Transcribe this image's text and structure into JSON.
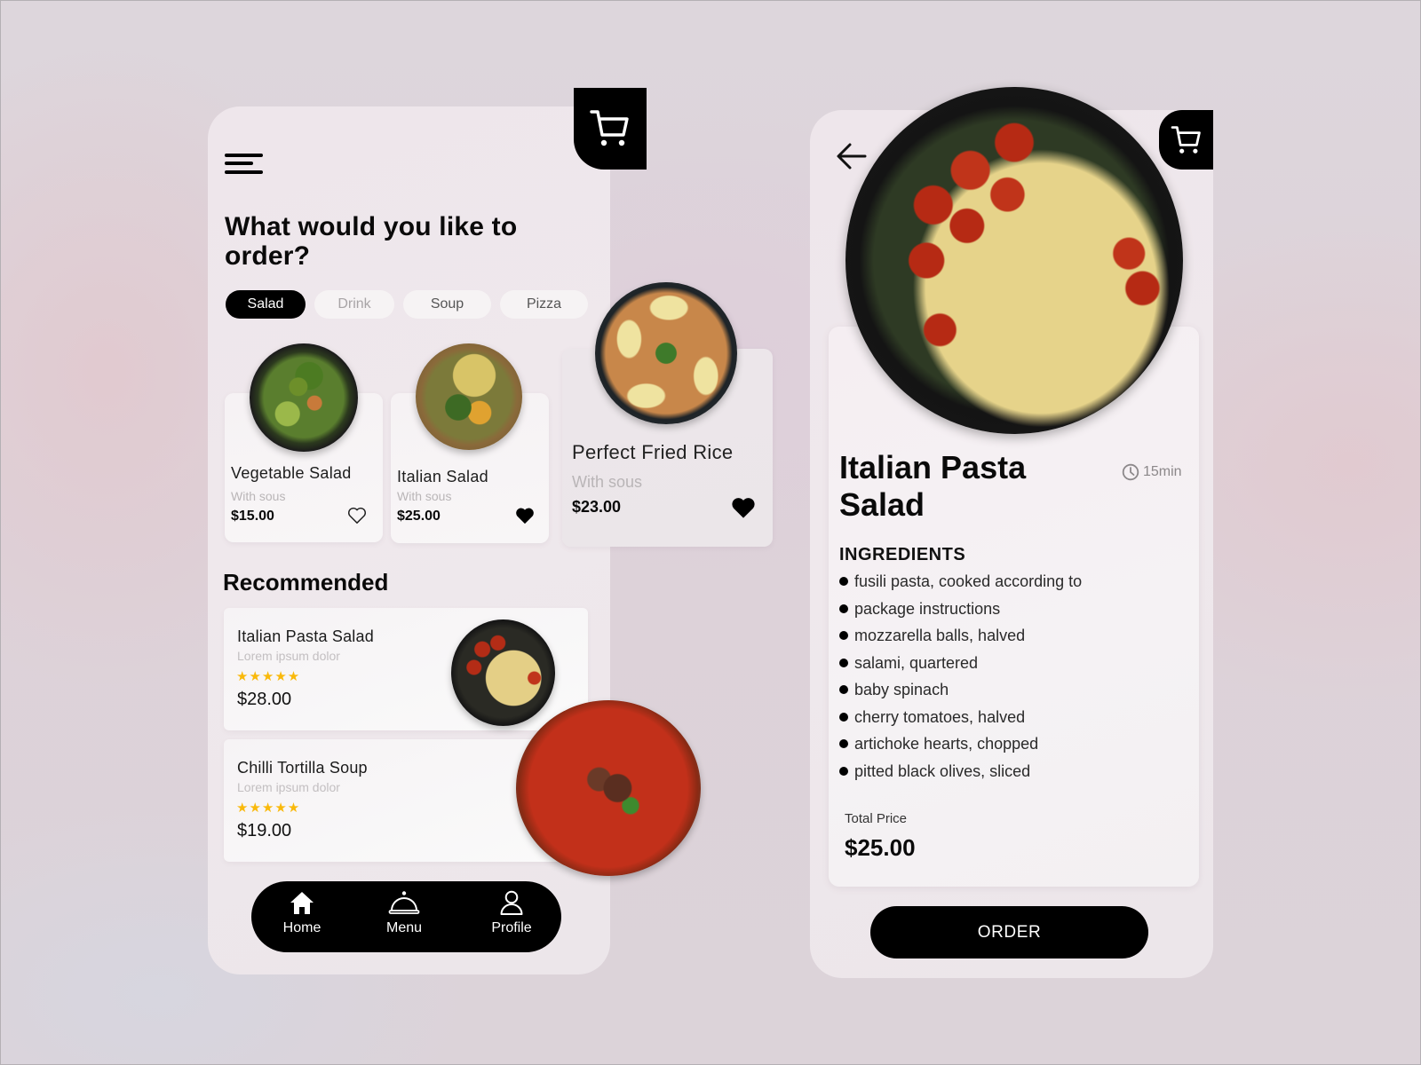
{
  "home": {
    "title": "What would you like to order?",
    "categories": [
      {
        "label": "Salad",
        "active": true
      },
      {
        "label": "Drink",
        "active": false
      },
      {
        "label": "Soup",
        "active": false
      },
      {
        "label": "Pizza",
        "active": false
      }
    ],
    "featured": [
      {
        "name": "Vegetable Salad",
        "subtitle": "With sous",
        "price": "$15.00",
        "favorite": false
      },
      {
        "name": "Italian Salad",
        "subtitle": "With sous",
        "price": "$25.00",
        "favorite": true
      },
      {
        "name": "Perfect Fried Rice",
        "subtitle": "With sous",
        "price": "$23.00",
        "favorite": true
      }
    ],
    "recommended_title": "Recommended",
    "recommended": [
      {
        "name": "Italian Pasta Salad",
        "subtitle": "Lorem ipsum dolor",
        "rating": 5,
        "stars": "★★★★★",
        "price": "$28.00"
      },
      {
        "name": "Chilli Tortilla Soup",
        "subtitle": "Lorem ipsum dolor",
        "rating": 5,
        "stars": "★★★★★",
        "price": "$19.00"
      }
    ],
    "nav": [
      {
        "label": "Home",
        "icon": "home-icon"
      },
      {
        "label": "Menu",
        "icon": "cloche-icon"
      },
      {
        "label": "Profile",
        "icon": "user-icon"
      }
    ]
  },
  "detail": {
    "title": "Italian Pasta Salad",
    "time": "15min",
    "ingredients_title": "INGREDIENTS",
    "ingredients": [
      "fusili pasta, cooked according to",
      "package instructions",
      "mozzarella balls, halved",
      "salami, quartered",
      "baby spinach",
      "cherry tomatoes, halved",
      "artichoke hearts, chopped",
      "pitted black olives, sliced"
    ],
    "total_label": "Total Price",
    "total_value": "$25.00",
    "order_label": "ORDER"
  },
  "colors": {
    "accent": "#000000",
    "star": "#f9b90b",
    "muted_text": "#b9b5b7"
  }
}
